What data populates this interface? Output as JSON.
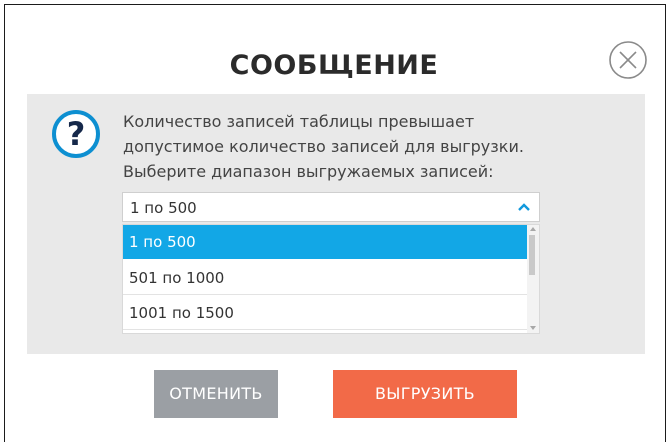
{
  "dialog": {
    "title": "СООБЩЕНИЕ",
    "message_lines": [
      "Количество записей таблицы превышает",
      "допустимое количество записей для выгрузки.",
      "Выберите диапазон выгружаемых записей:"
    ]
  },
  "range_select": {
    "selected": "1 по 500",
    "options": [
      "1 по 500",
      "501 по 1000",
      "1001 по 1500"
    ],
    "expanded": true
  },
  "buttons": {
    "cancel_label": "ОТМЕНИТЬ",
    "export_label": "ВЫГРУЗИТЬ"
  },
  "icons": {
    "close": "close-circle-icon",
    "question": "question-circle-icon",
    "chevron": "chevron-up-icon"
  },
  "colors": {
    "accent": "#12a7e6",
    "cancel_button": "#9b9fa4",
    "export_button": "#f26a48",
    "panel": "#e9e9e9"
  }
}
